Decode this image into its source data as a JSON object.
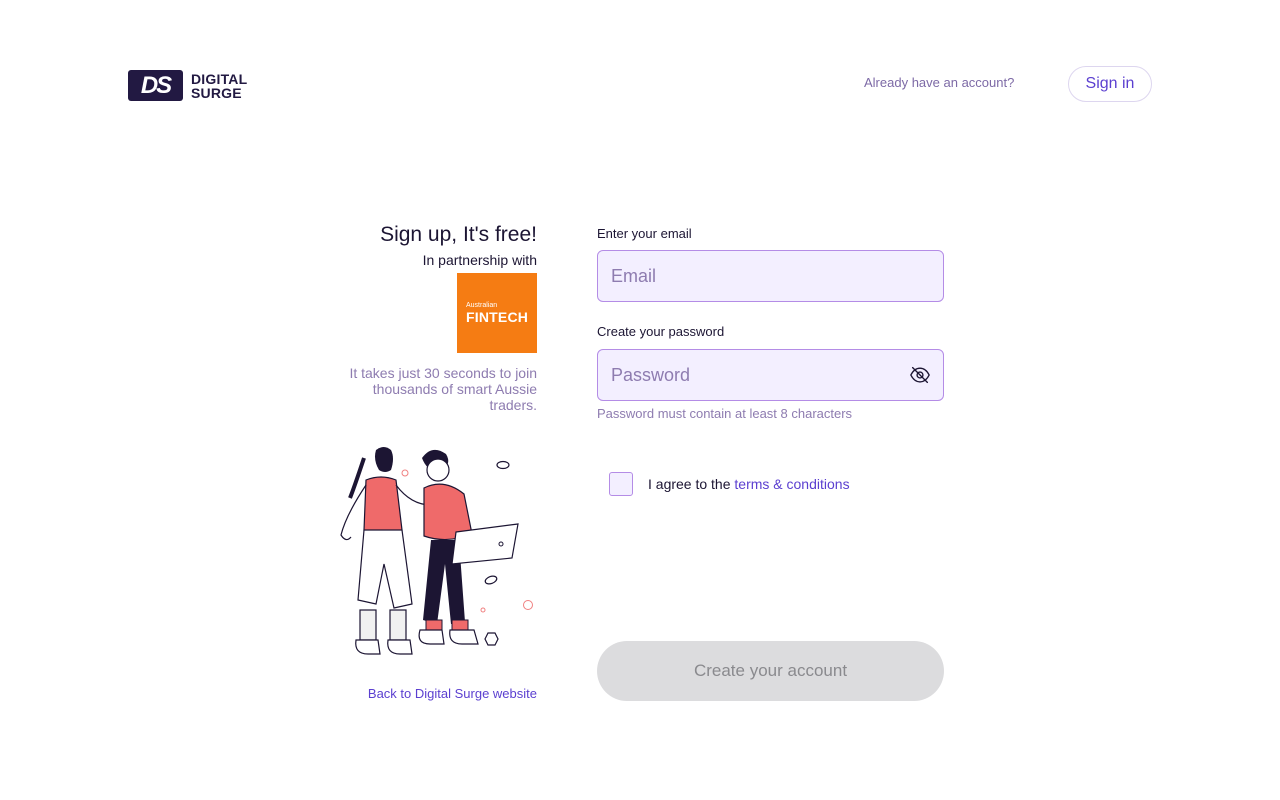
{
  "header": {
    "logo_mark": "DS",
    "logo_line1": "DIGITAL",
    "logo_line2": "SURGE",
    "already_text": "Already have an account?",
    "signin_label": "Sign in"
  },
  "intro": {
    "title": "Sign up, It's free!",
    "partner_text": "In partnership with",
    "partner_logo_small": "Australian",
    "partner_logo_big": "FINTECH",
    "tagline": "It takes just 30 seconds to join thousands of smart Aussie traders.",
    "back_link": "Back to Digital Surge website"
  },
  "form": {
    "email_label": "Enter your email",
    "email_placeholder": "Email",
    "email_value": "",
    "password_label": "Create your password",
    "password_placeholder": "Password",
    "password_value": "",
    "password_hint": "Password must contain at least 8 characters",
    "agree_prefix": "I agree to the ",
    "terms_link": "terms & conditions",
    "agree_checked": false,
    "submit_label": "Create your account"
  },
  "colors": {
    "brand_dark": "#221942",
    "accent": "#5b3fd0",
    "input_bg": "#f3efff",
    "input_border": "#b48ce6",
    "fintech_orange": "#f57c13",
    "button_disabled": "#dcdcde"
  }
}
